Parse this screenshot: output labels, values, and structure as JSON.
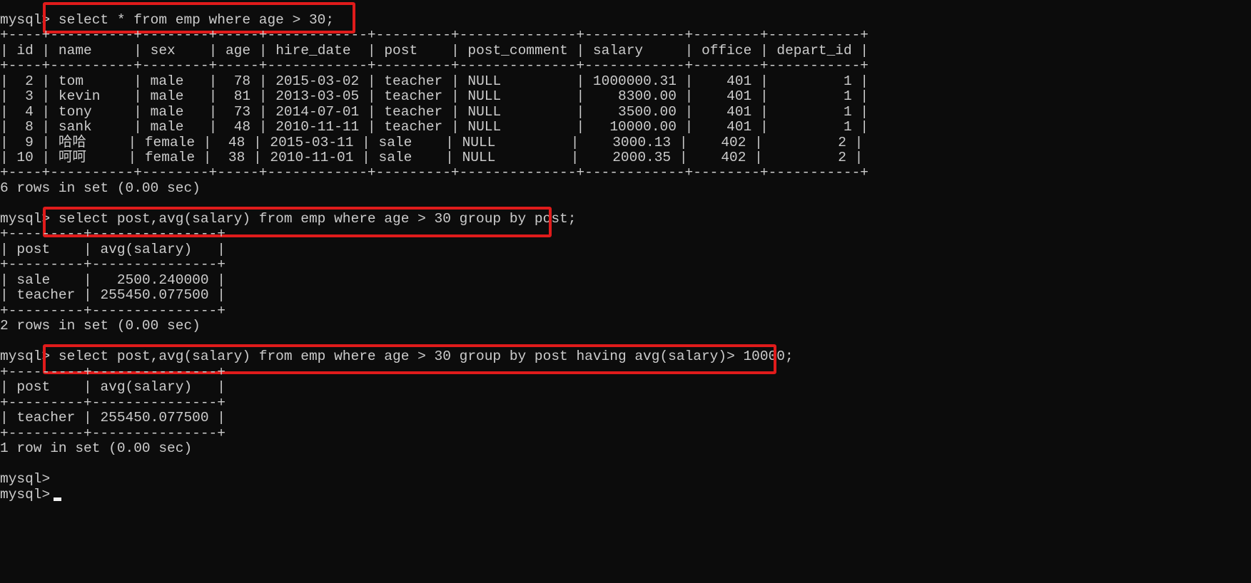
{
  "terminal": {
    "prompt": "mysql>",
    "queries": [
      "select * from emp where age > 30;",
      "select post,avg(salary) from emp where age > 30 group by post;",
      "select post,avg(salary) from emp where age > 30 group by post having avg(salary)> 10000;"
    ],
    "results": [
      {
        "columns": [
          "id",
          "name",
          "sex",
          "age",
          "hire_date",
          "post",
          "post_comment",
          "salary",
          "office",
          "depart_id"
        ],
        "rows": [
          [
            "2",
            "tom",
            "male",
            "78",
            "2015-03-02",
            "teacher",
            "NULL",
            "1000000.31",
            "401",
            "1"
          ],
          [
            "3",
            "kevin",
            "male",
            "81",
            "2013-03-05",
            "teacher",
            "NULL",
            "8300.00",
            "401",
            "1"
          ],
          [
            "4",
            "tony",
            "male",
            "73",
            "2014-07-01",
            "teacher",
            "NULL",
            "3500.00",
            "401",
            "1"
          ],
          [
            "8",
            "sank",
            "male",
            "48",
            "2010-11-11",
            "teacher",
            "NULL",
            "10000.00",
            "401",
            "1"
          ],
          [
            "9",
            "哈哈",
            "female",
            "48",
            "2015-03-11",
            "sale",
            "NULL",
            "3000.13",
            "402",
            "2"
          ],
          [
            "10",
            "呵呵",
            "female",
            "38",
            "2010-11-01",
            "sale",
            "NULL",
            "2000.35",
            "402",
            "2"
          ]
        ],
        "summary": "6 rows in set (0.00 sec)"
      },
      {
        "columns": [
          "post",
          "avg(salary)"
        ],
        "rows": [
          [
            "sale",
            "2500.240000"
          ],
          [
            "teacher",
            "255450.077500"
          ]
        ],
        "summary": "2 rows in set (0.00 sec)"
      },
      {
        "columns": [
          "post",
          "avg(salary)"
        ],
        "rows": [
          [
            "teacher",
            "255450.077500"
          ]
        ],
        "summary": "1 row in set (0.00 sec)"
      }
    ],
    "highlight_color": "#e01b1b",
    "background_color": "#0c0c0c",
    "text_color": "#cccccc"
  }
}
